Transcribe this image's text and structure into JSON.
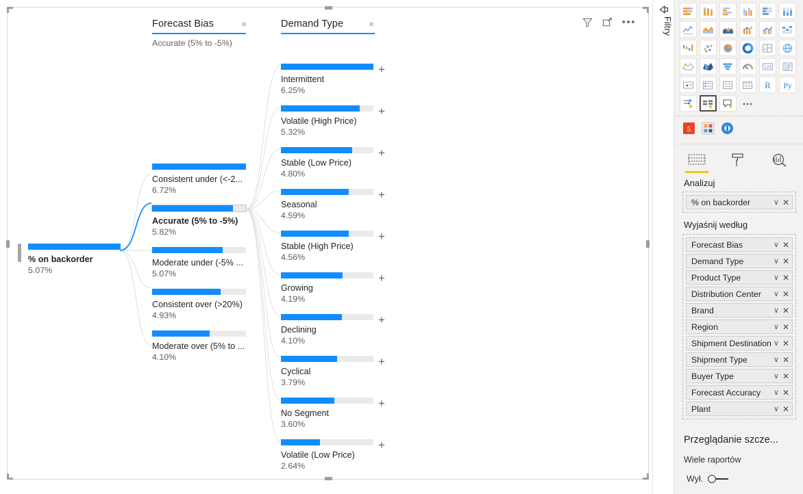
{
  "visual": {
    "header_icons": [
      "filter-icon",
      "focus-mode-icon",
      "more-options-icon"
    ],
    "levels": [
      {
        "title": "Forecast Bias",
        "subtitle": "Accurate (5% to -5%)",
        "close": "×"
      },
      {
        "title": "Demand Type",
        "subtitle": "",
        "close": "×"
      }
    ],
    "root": {
      "label": "% on backorder",
      "value": "5.07%",
      "fill_pct": 100
    },
    "level1_nodes": [
      {
        "label": "Consistent under (<-2...",
        "value": "6.72%",
        "fill_pct": 100
      },
      {
        "label": "Accurate (5% to -5%)",
        "value": "5.82%",
        "fill_pct": 86,
        "selected": true
      },
      {
        "label": "Moderate under (-5% ...",
        "value": "5.07%",
        "fill_pct": 75
      },
      {
        "label": "Consistent over (>20%)",
        "value": "4.93%",
        "fill_pct": 73
      },
      {
        "label": "Moderate over (5% to ...",
        "value": "4.10%",
        "fill_pct": 61
      }
    ],
    "level2_nodes": [
      {
        "label": "Intermittent",
        "value": "6.25%",
        "fill_pct": 100,
        "expand": "+"
      },
      {
        "label": "Volatile (High Price)",
        "value": "5.32%",
        "fill_pct": 85,
        "expand": "+"
      },
      {
        "label": "Stable (Low Price)",
        "value": "4.80%",
        "fill_pct": 77,
        "expand": "+"
      },
      {
        "label": "Seasonal",
        "value": "4.59%",
        "fill_pct": 73,
        "expand": "+"
      },
      {
        "label": "Stable (High Price)",
        "value": "4.56%",
        "fill_pct": 73,
        "expand": "+"
      },
      {
        "label": "Growing",
        "value": "4.19%",
        "fill_pct": 67,
        "expand": "+"
      },
      {
        "label": "Declining",
        "value": "4.10%",
        "fill_pct": 66,
        "expand": "+"
      },
      {
        "label": "Cyclical",
        "value": "3.79%",
        "fill_pct": 61,
        "expand": "+"
      },
      {
        "label": "No Segment",
        "value": "3.60%",
        "fill_pct": 58,
        "expand": "+"
      },
      {
        "label": "Volatile (Low Price)",
        "value": "2.64%",
        "fill_pct": 42,
        "expand": "+"
      }
    ]
  },
  "filters_pane": {
    "label": "Filtry",
    "expand_icon": "expand-pane-icon"
  },
  "viz_pane": {
    "gallery_icons": [
      "stacked-bar-chart-icon",
      "stacked-column-chart-icon",
      "clustered-bar-chart-icon",
      "clustered-column-chart-icon",
      "100-stacked-bar-chart-icon",
      "100-stacked-column-chart-icon",
      "line-chart-icon",
      "area-chart-icon",
      "stacked-area-chart-icon",
      "line-stacked-column-chart-icon",
      "line-clustered-column-chart-icon",
      "ribbon-chart-icon",
      "waterfall-chart-icon",
      "scatter-chart-icon",
      "pie-chart-icon",
      "donut-chart-icon",
      "treemap-icon",
      "map-icon",
      "filled-map-icon",
      "shape-map-icon",
      "funnel-icon",
      "gauge-icon",
      "card-icon",
      "multi-row-card-icon",
      "kpi-icon",
      "slicer-icon",
      "table-icon",
      "matrix-icon",
      "r-script-visual-icon",
      "python-visual-icon",
      "key-influencers-icon",
      "decomposition-tree-icon",
      "qna-icon",
      "more-visuals-icon"
    ],
    "selected_gallery_icon": "decomposition-tree-icon",
    "custom_icons": [
      "html-content-icon",
      "smart-filter-icon",
      "power-apps-icon"
    ],
    "tabs": [
      {
        "name": "fields-tab",
        "icon": "fields-icon",
        "active": true
      },
      {
        "name": "format-tab",
        "icon": "paint-roller-icon",
        "active": false
      },
      {
        "name": "analytics-tab",
        "icon": "magnifier-chart-icon",
        "active": false
      }
    ],
    "analyze_label": "Analizuj",
    "measure_field": {
      "name": "% on backorder",
      "chevron": "∨",
      "close": "✕"
    },
    "explain_by_label": "Wyjaśnij według",
    "explain_by_fields": [
      {
        "name": "Forecast Bias"
      },
      {
        "name": "Demand Type"
      },
      {
        "name": "Product Type"
      },
      {
        "name": "Distribution Center"
      },
      {
        "name": "Brand"
      },
      {
        "name": "Region"
      },
      {
        "name": "Shipment Destination"
      },
      {
        "name": "Shipment Type"
      },
      {
        "name": "Buyer Type"
      },
      {
        "name": "Forecast Accuracy"
      },
      {
        "name": "Plant"
      }
    ],
    "chevron_glyph": "∨",
    "close_glyph": "✕",
    "drilldown": {
      "title": "Przeglądanie szcze...",
      "subtitle": "Wiele raportów",
      "toggle_label": "Wył."
    }
  },
  "colors": {
    "accent_blue": "#118dff",
    "track_gray": "#eaeaea",
    "pane_bg": "#f3f2f1",
    "tab_highlight": "#f2c811"
  }
}
